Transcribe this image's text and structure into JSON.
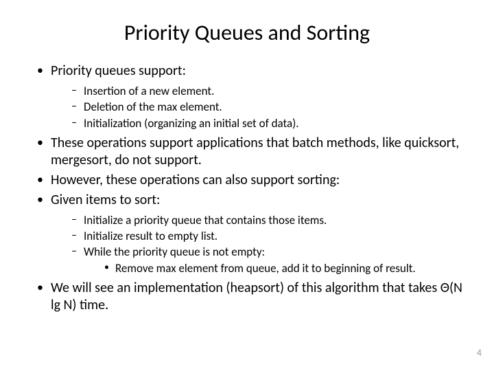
{
  "title": "Priority Queues and Sorting",
  "bullets": {
    "b0": "Priority queues support:",
    "b0_sub": {
      "s0": "Insertion of a new element.",
      "s1": "Deletion of the max element.",
      "s2": "Initialization (organizing an initial set of data)."
    },
    "b1": "These operations support applications that batch methods, like quicksort, mergesort, do not support.",
    "b2": "However, these operations can also support sorting:",
    "b3": "Given items to sort:",
    "b3_sub": {
      "s0": "Initialize a priority queue that contains those items.",
      "s1": "Initialize result to empty list.",
      "s2": "While the priority queue is not empty:",
      "s2_sub": {
        "t0": "Remove max element from queue, add it to beginning of result."
      }
    },
    "b4": "We will see an implementation (heapsort) of this algorithm that takes Θ(N lg N) time."
  },
  "page_number": "4"
}
